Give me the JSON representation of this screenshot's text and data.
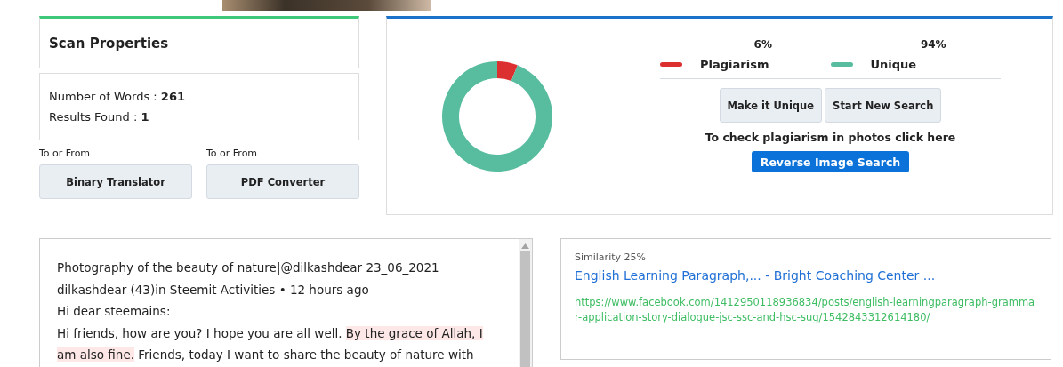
{
  "banner": {
    "photo": true
  },
  "scan_properties": {
    "title": "Scan Properties",
    "words_label": "Number of Words :",
    "words_value": "261",
    "results_label": "Results Found :",
    "results_value": "1"
  },
  "tools": [
    {
      "caption": "To or From",
      "button": "Binary Translator"
    },
    {
      "caption": "To or From",
      "button": "PDF Converter"
    }
  ],
  "result": {
    "chart_data": {
      "type": "donut",
      "categories": [
        "Plagiarism",
        "Unique"
      ],
      "values": [
        6,
        94
      ]
    },
    "legend": [
      {
        "value": "6%",
        "color": "#dc2f2f"
      },
      {
        "value": "94%",
        "color": "#57bd9e"
      }
    ],
    "buttons": [
      "Make it Unique",
      "Start New Search"
    ],
    "photo_note": "To check plagiarism in photos click here",
    "reverse_button": "Reverse Image Search"
  },
  "content": {
    "paragraphs": [
      [
        {
          "text": "Photography of the beauty of nature|@dilkashdear 23_06_2021",
          "highlighted": false
        }
      ],
      [
        {
          "text": "dilkashdear (43)in Steemit Activities • 12 hours ago",
          "highlighted": false
        }
      ],
      [
        {
          "text": "Hi dear steemains:",
          "highlighted": false
        }
      ],
      [
        {
          "text": "Hi friends, how are you? I hope you are all well. ",
          "highlighted": false
        },
        {
          "text": "By the grace of Allah, I am also fine.",
          "highlighted": true
        },
        {
          "text": " Friends, today I want to share the beauty of nature with",
          "highlighted": false
        }
      ]
    ]
  },
  "matches": [
    {
      "similarity": "Similarity 25%",
      "title": "English Learning Paragraph,... - Bright Coaching Center ...",
      "url": "https://www.facebook.com/1412950118936834/posts/english-learningparagraph-grammar-application-story-dialogue-jsc-ssc-and-hsc-sug/1542843312614180/"
    }
  ]
}
